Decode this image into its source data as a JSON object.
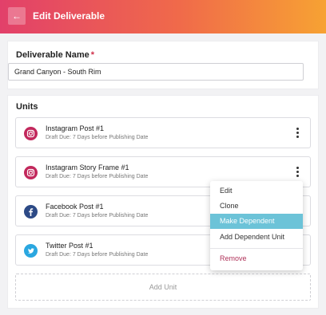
{
  "header": {
    "title": "Edit Deliverable",
    "back_icon": "←"
  },
  "deliverable": {
    "label": "Deliverable Name",
    "required_mark": "*",
    "value": "Grand Canyon - South Rim"
  },
  "units": {
    "label": "Units",
    "items": [
      {
        "title": "Instagram Post #1",
        "subtitle": "Draft Due: 7 Days before Publishing Date",
        "icon": "instagram-icon",
        "icon_color": "#c2285c"
      },
      {
        "title": "Instagram Story Frame #1",
        "subtitle": "Draft Due: 7 Days before Publishing Date",
        "icon": "instagram-icon",
        "icon_color": "#c2285c"
      },
      {
        "title": "Facebook Post #1",
        "subtitle": "Draft Due: 7 Days before Publishing Date",
        "icon": "facebook-icon",
        "icon_color": "#2d4a86"
      },
      {
        "title": "Twitter Post #1",
        "subtitle": "Draft Due: 7 Days before Publishing Date",
        "icon": "twitter-icon",
        "icon_color": "#2aa7e0"
      }
    ],
    "add_label": "Add Unit"
  },
  "menu": {
    "items": [
      "Edit",
      "Clone",
      "Make Dependent",
      "Add Dependent Unit"
    ],
    "highlighted": "Make Dependent",
    "remove_label": "Remove"
  },
  "colors": {
    "header_gradient": [
      "#e2406a",
      "#f06a4a",
      "#f7a233"
    ],
    "highlight": "#6cc3d8",
    "danger": "#b0335a"
  }
}
